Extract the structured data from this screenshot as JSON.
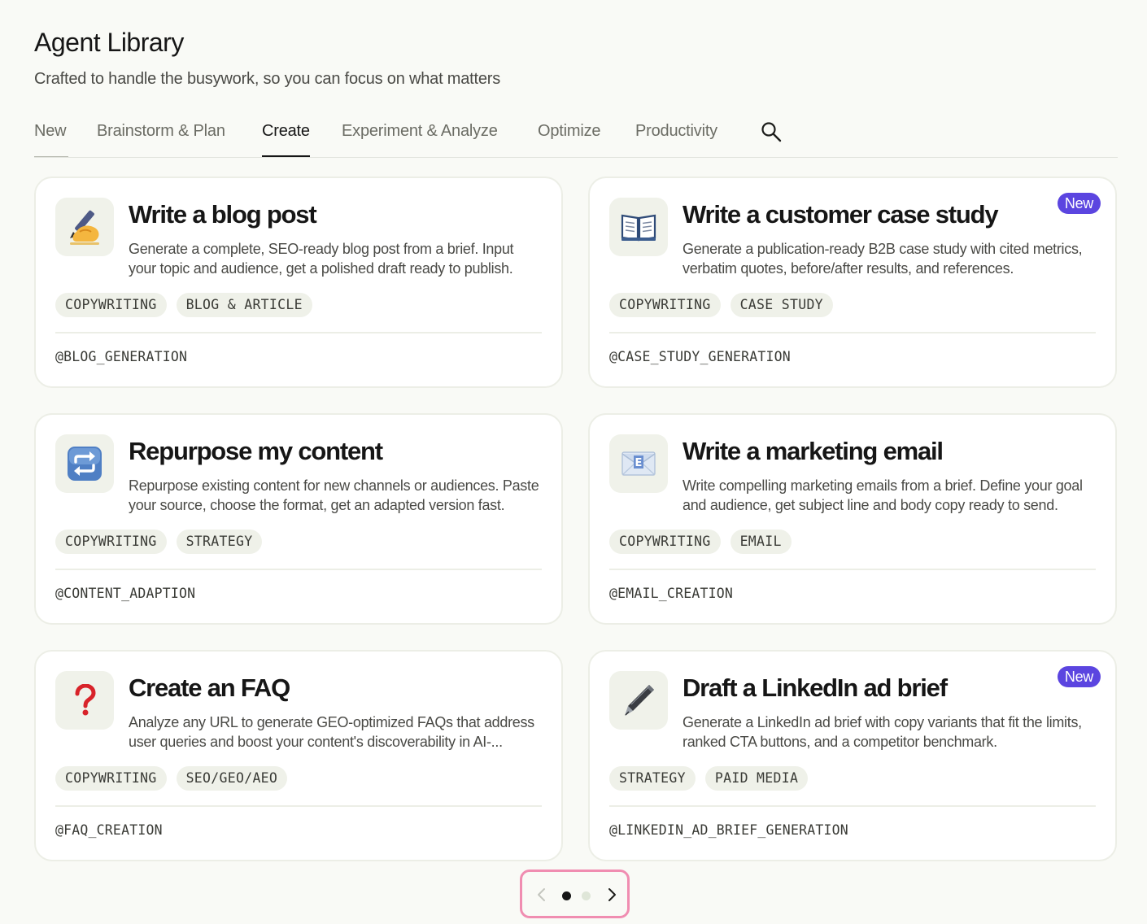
{
  "header": {
    "title": "Agent Library",
    "subtitle": "Crafted to handle the busywork, so you can focus on what matters"
  },
  "tabs": [
    {
      "label": "New"
    },
    {
      "label": "Brainstorm & Plan"
    },
    {
      "label": "Create",
      "active": true
    },
    {
      "label": "Experiment & Analyze"
    },
    {
      "label": "Optimize"
    },
    {
      "label": "Productivity"
    }
  ],
  "search": {
    "icon": "search-icon"
  },
  "cards": [
    {
      "icon": "writing-hand-icon",
      "emoji": "✍️",
      "title": "Write a blog post",
      "description": "Generate a complete, SEO-ready blog post from a brief. Input your topic and audience, get a polished draft ready to publish.",
      "tags": [
        "COPYWRITING",
        "BLOG & ARTICLE"
      ],
      "handle": "@BLOG_GENERATION",
      "badge": ""
    },
    {
      "icon": "open-book-icon",
      "emoji": "📖",
      "title": "Write a customer case study",
      "description": "Generate a publication-ready B2B case study with cited metrics, verbatim quotes, before/after results, and references.",
      "tags": [
        "COPYWRITING",
        "CASE STUDY"
      ],
      "handle": "@CASE_STUDY_GENERATION",
      "badge": "New"
    },
    {
      "icon": "repeat-arrows-icon",
      "emoji": "🔁",
      "title": "Repurpose my content",
      "description": "Repurpose existing content for new channels or audiences. Paste your source, choose the format, get an adapted version fast.",
      "tags": [
        "COPYWRITING",
        "STRATEGY"
      ],
      "handle": "@CONTENT_ADAPTION",
      "badge": ""
    },
    {
      "icon": "email-envelope-icon",
      "emoji": "📧",
      "title": "Write a marketing email",
      "description": "Write compelling marketing emails from a brief. Define your goal and audience, get subject line and body copy ready to send.",
      "tags": [
        "COPYWRITING",
        "EMAIL"
      ],
      "handle": "@EMAIL_CREATION",
      "badge": ""
    },
    {
      "icon": "question-mark-icon",
      "emoji": "❓",
      "title": "Create an FAQ",
      "description": "Analyze any URL to generate GEO-optimized FAQs that address user queries and boost your content's discoverability in AI-...",
      "tags": [
        "COPYWRITING",
        "SEO/GEO/AEO"
      ],
      "handle": "@FAQ_CREATION",
      "badge": ""
    },
    {
      "icon": "pen-icon",
      "emoji": "🖊️",
      "title": "Draft a LinkedIn ad brief",
      "description": "Generate a LinkedIn ad brief with copy variants that fit the limits, ranked CTA buttons, and a competitor benchmark.",
      "tags": [
        "STRATEGY",
        "PAID MEDIA"
      ],
      "handle": "@LINKEDIN_AD_BRIEF_GENERATION",
      "badge": "New"
    }
  ],
  "pagination": {
    "current_page": 1,
    "total_pages": 2,
    "prev_icon": "chevron-left-icon",
    "next_icon": "chevron-right-icon"
  },
  "colors": {
    "background": "#f9faf6",
    "accent_badge": "#5b45e0",
    "pager_highlight": "#f08db1"
  }
}
